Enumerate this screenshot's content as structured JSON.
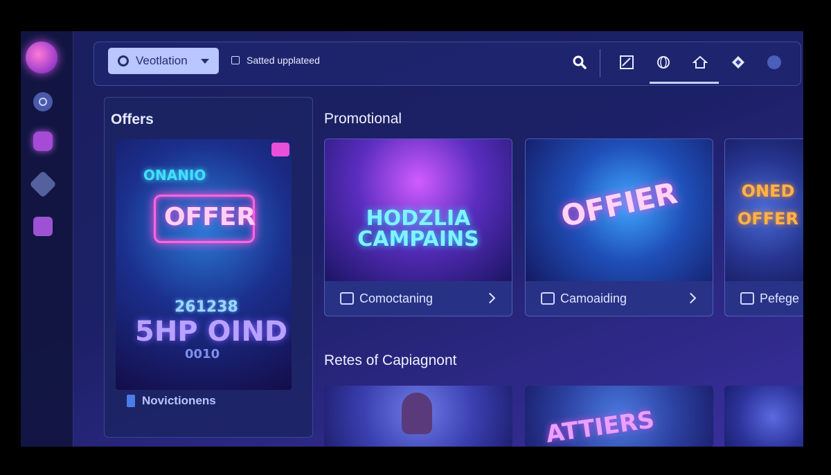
{
  "header": {
    "dropdown_value": "Veotlation",
    "checkbox_label": "Satted upplateed"
  },
  "icons": {
    "search": "search-icon",
    "toolbar": [
      "grid-icon",
      "globe-icon",
      "home-icon",
      "diamond-icon",
      "circle-icon"
    ],
    "sidebar": [
      "avatar",
      "settings-icon",
      "gamepad-icon",
      "diamond-icon",
      "folder-icon"
    ]
  },
  "offers": {
    "title": "Offers",
    "image_text_main": "OFFER",
    "image_text_top": "ONANIO",
    "image_text_small": "261238",
    "image_text_big": "5HP OIND",
    "image_text_sub": "0010",
    "footer_label": "Novictionens"
  },
  "promotional": {
    "title": "Promotional",
    "cards": [
      {
        "image_text": "HODZLIA CAMPAINS",
        "label": "Comoctaning"
      },
      {
        "image_text": "OFFIER",
        "label": "Camoaiding"
      },
      {
        "image_text": "ONED OFFER",
        "label": "Pefege"
      }
    ]
  },
  "rates": {
    "title": "Retes of Capiagnont",
    "card_texts": [
      "",
      "ATTIERS",
      ""
    ]
  },
  "colors": {
    "accent_pink": "#ff4fd8",
    "accent_cyan": "#3fe0ff",
    "panel_bg": "#1c2466",
    "dropdown_bg": "#b9c6ff"
  }
}
